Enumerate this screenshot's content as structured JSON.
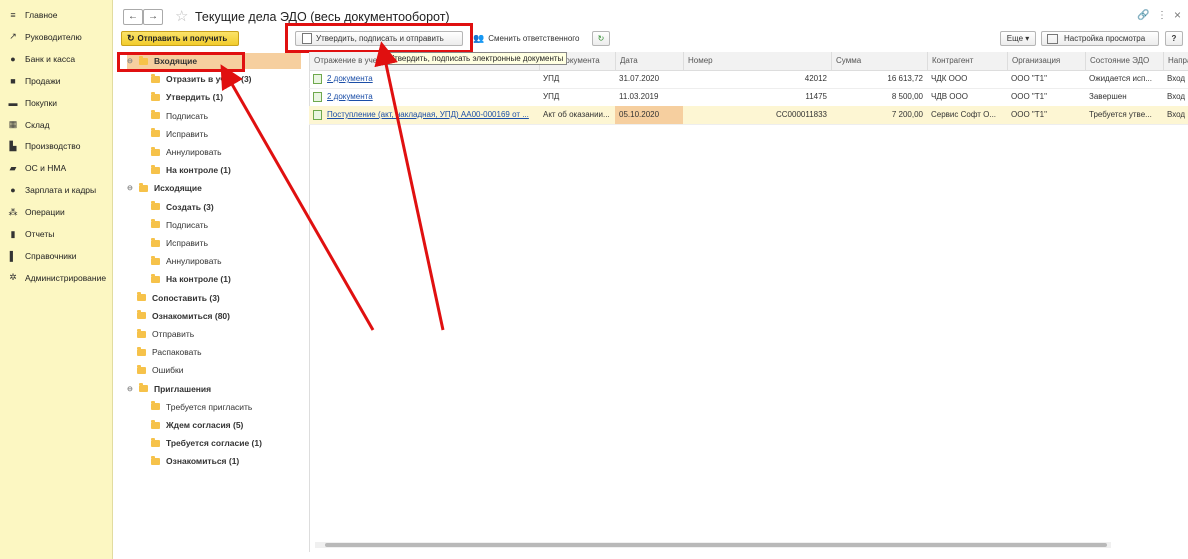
{
  "sidebar": {
    "items": [
      {
        "label": "Главное",
        "icon": "menu-icon"
      },
      {
        "label": "Руководителю",
        "icon": "trend-icon"
      },
      {
        "label": "Банк и касса",
        "icon": "coin-icon"
      },
      {
        "label": "Продажи",
        "icon": "bag-icon"
      },
      {
        "label": "Покупки",
        "icon": "cart-icon"
      },
      {
        "label": "Склад",
        "icon": "warehouse-icon"
      },
      {
        "label": "Производство",
        "icon": "factory-icon"
      },
      {
        "label": "ОС и НМА",
        "icon": "truck-icon"
      },
      {
        "label": "Зарплата и кадры",
        "icon": "person-icon"
      },
      {
        "label": "Операции",
        "icon": "operations-icon"
      },
      {
        "label": "Отчеты",
        "icon": "chart-icon"
      },
      {
        "label": "Справочники",
        "icon": "book-icon"
      },
      {
        "label": "Администрирование",
        "icon": "gear-icon"
      }
    ]
  },
  "header": {
    "title": "Текущие дела ЭДО (весь документооборот)",
    "back": "←",
    "forward": "→",
    "link": "🔗",
    "more": "⋮",
    "close": "×"
  },
  "toolbar": {
    "send_receive": "Отправить и получить",
    "approve_sign_send": "Утвердить, подписать и отправить",
    "change_responsible": "Сменить ответственного",
    "refresh": "↻",
    "more": "Еще ▾",
    "view_settings": "Настройка просмотра",
    "help": "?",
    "tooltip": "Утвердить, подписать электронные документы"
  },
  "tree": [
    {
      "label": "Входящие",
      "level": 0,
      "bold": true,
      "expander": "⊖",
      "selected": true
    },
    {
      "label": "Отразить в учете (3)",
      "level": 1,
      "bold": true
    },
    {
      "label": "Утвердить (1)",
      "level": 1,
      "bold": true
    },
    {
      "label": "Подписать",
      "level": 1,
      "bold": false
    },
    {
      "label": "Исправить",
      "level": 1,
      "bold": false
    },
    {
      "label": "Аннулировать",
      "level": 1,
      "bold": false
    },
    {
      "label": "На контроле (1)",
      "level": 1,
      "bold": true
    },
    {
      "label": "Исходящие",
      "level": 0,
      "bold": true,
      "expander": "⊖"
    },
    {
      "label": "Создать (3)",
      "level": 1,
      "bold": true
    },
    {
      "label": "Подписать",
      "level": 1,
      "bold": false
    },
    {
      "label": "Исправить",
      "level": 1,
      "bold": false
    },
    {
      "label": "Аннулировать",
      "level": 1,
      "bold": false
    },
    {
      "label": "На контроле (1)",
      "level": 1,
      "bold": true
    },
    {
      "label": "Сопоставить (3)",
      "level": 0,
      "bold": true
    },
    {
      "label": "Ознакомиться (80)",
      "level": 0,
      "bold": true
    },
    {
      "label": "Отправить",
      "level": 0,
      "bold": false
    },
    {
      "label": "Распаковать",
      "level": 0,
      "bold": false
    },
    {
      "label": "Ошибки",
      "level": 0,
      "bold": false
    },
    {
      "label": "Приглашения",
      "level": 0,
      "bold": true,
      "expander": "⊖"
    },
    {
      "label": "Требуется пригласить",
      "level": 1,
      "bold": false
    },
    {
      "label": "Ждем согласия (5)",
      "level": 1,
      "bold": true
    },
    {
      "label": "Требуется согласие (1)",
      "level": 1,
      "bold": true
    },
    {
      "label": "Ознакомиться (1)",
      "level": 1,
      "bold": true
    }
  ],
  "grid": {
    "columns": [
      "Отражение в учете",
      "Вид документа",
      "Дата",
      "Номер",
      "Сумма",
      "Контрагент",
      "Организация",
      "Состояние ЭДО",
      "Направление"
    ],
    "rows": [
      {
        "doc": "2 документа",
        "kind": "УПД",
        "date": "31.07.2020",
        "number": "42012",
        "sum": "16 613,72",
        "counterparty": "ЧДК ООО",
        "org": "ООО \"Т1\"",
        "state": "Ожидается исп...",
        "direction": "Вход"
      },
      {
        "doc": "2 документа",
        "kind": "УПД",
        "date": "11.03.2019",
        "number": "11475",
        "sum": "8 500,00",
        "counterparty": "ЧДВ ООО",
        "org": "ООО \"Т1\"",
        "state": "Завершен",
        "direction": "Вход"
      },
      {
        "doc": "Поступление (акт, накладная, УПД) АА00-000169 от ...",
        "kind": "Акт об оказании...",
        "date": "05.10.2020",
        "number": "СС000011833",
        "sum": "7 200,00",
        "counterparty": "Сервис Софт О...",
        "org": "ООО \"Т1\"",
        "state": "Требуется утве...",
        "direction": "Вход"
      }
    ]
  }
}
